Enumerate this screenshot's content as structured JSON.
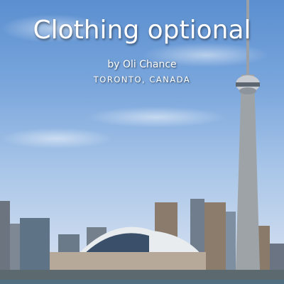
{
  "title": "Clothing optional",
  "byline": "by Oli Chance",
  "location": "TORONTO, CANADA",
  "colors": {
    "sky": "#7aa6dc",
    "text": "#ffffff"
  }
}
